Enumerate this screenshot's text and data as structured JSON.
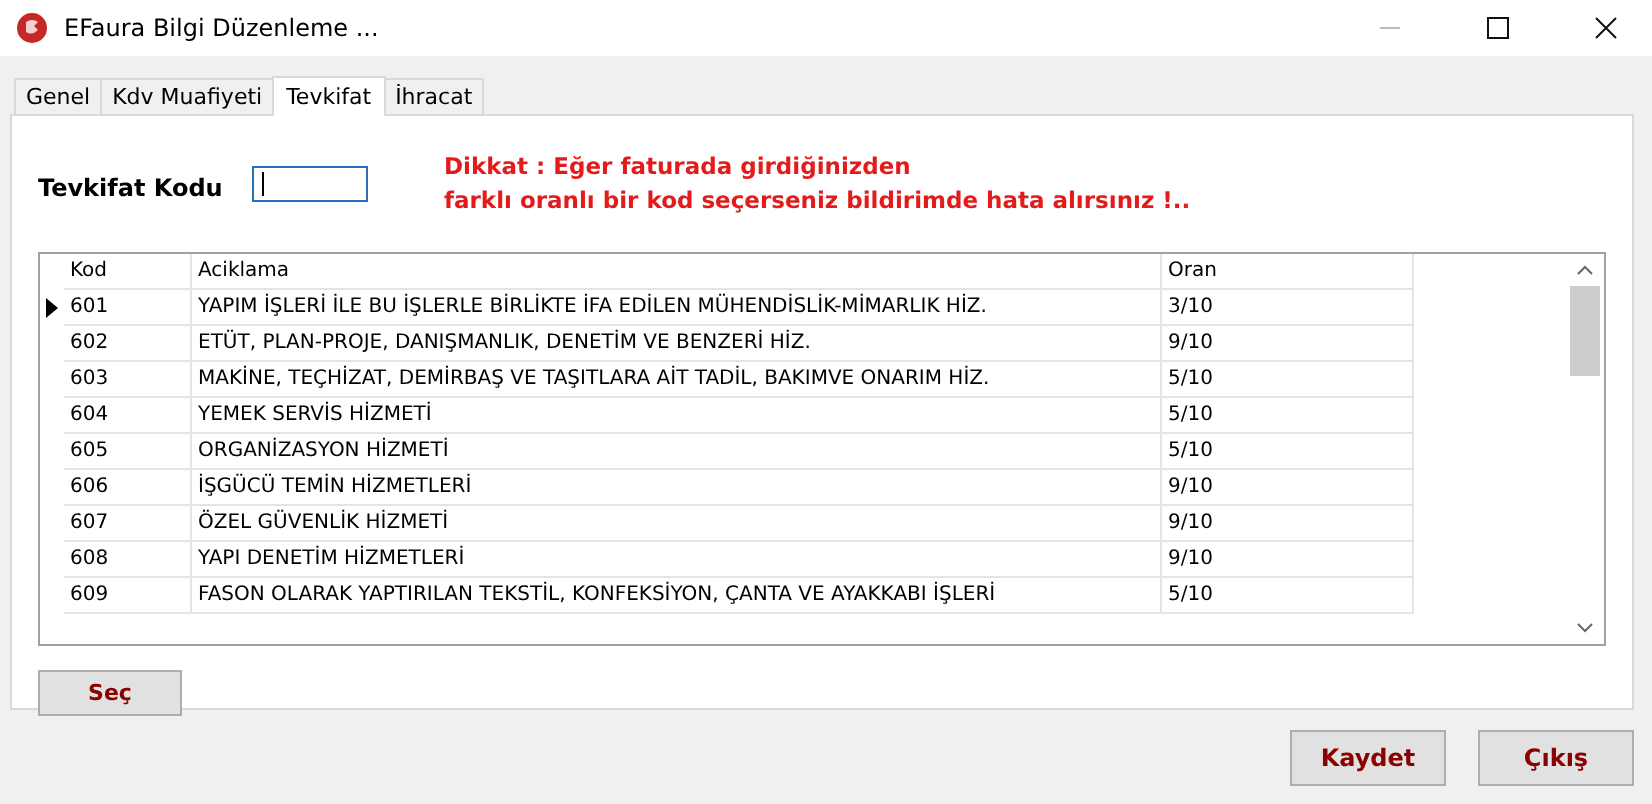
{
  "window": {
    "title": "EFaura Bilgi Düzenleme ..."
  },
  "tabs": [
    {
      "label": "Genel",
      "selected": false
    },
    {
      "label": "Kdv Muafiyeti",
      "selected": false
    },
    {
      "label": "Tevkifat",
      "selected": true
    },
    {
      "label": "İhracat",
      "selected": false
    }
  ],
  "code_field": {
    "label": "Tevkifat Kodu"
  },
  "warning": [
    "Dikkat : Eğer faturada girdiğinizden",
    "farklı oranlı bir kod seçerseniz bildirimde hata alırsınız !.."
  ],
  "table": {
    "columns": [
      "Kod",
      "Aciklama",
      "Oran"
    ],
    "rows": [
      {
        "cells": [
          "601",
          "YAPIM İŞLERİ İLE BU İŞLERLE BİRLİKTE İFA EDİLEN MÜHENDİSLİK-MİMARLIK HİZ.",
          "3/10"
        ],
        "selected": true
      },
      {
        "cells": [
          "602",
          "ETÜT, PLAN-PROJE, DANIŞMANLIK, DENETİM VE BENZERİ HİZ.",
          "9/10"
        ],
        "selected": false
      },
      {
        "cells": [
          "603",
          "MAKİNE, TEÇHİZAT, DEMİRBAŞ VE TAŞITLARA AİT TADİL, BAKIMVE ONARIM HİZ.",
          "5/10"
        ],
        "selected": false
      },
      {
        "cells": [
          "604",
          "YEMEK SERVİS HİZMETİ",
          "5/10"
        ],
        "selected": false
      },
      {
        "cells": [
          "605",
          "ORGANİZASYON HİZMETİ",
          "5/10"
        ],
        "selected": false
      },
      {
        "cells": [
          "606",
          "İŞGÜCÜ TEMİN HİZMETLERİ",
          "9/10"
        ],
        "selected": false
      },
      {
        "cells": [
          "607",
          "ÖZEL GÜVENLİK HİZMETİ",
          "9/10"
        ],
        "selected": false
      },
      {
        "cells": [
          "608",
          "YAPI DENETİM HİZMETLERİ",
          "9/10"
        ],
        "selected": false
      },
      {
        "cells": [
          "609",
          "FASON OLARAK YAPTIRILAN TEKSTİL, KONFEKSİYON, ÇANTA VE AYAKKABI İŞLERİ",
          "5/10"
        ],
        "selected": false
      }
    ]
  },
  "select_button": "Seç",
  "buttons": [
    "Kaydet",
    "Çıkış"
  ]
}
